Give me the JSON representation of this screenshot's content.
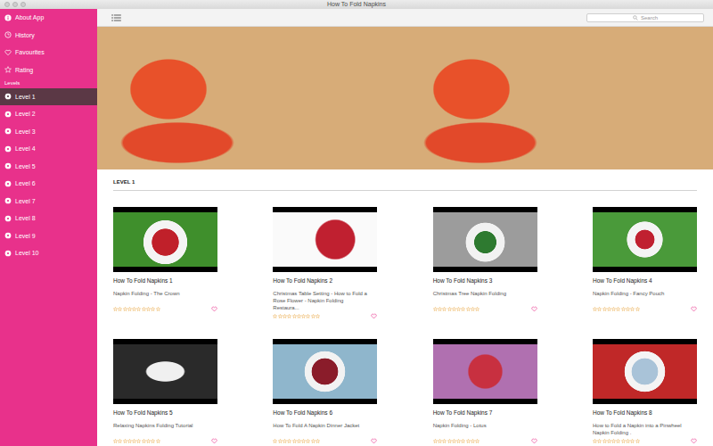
{
  "window": {
    "title": "How To Fold Napkins"
  },
  "sidebar": {
    "menu": [
      {
        "label": "About App",
        "kind": "info"
      },
      {
        "label": "History",
        "kind": "history"
      },
      {
        "label": "Favourites",
        "kind": "favourites"
      },
      {
        "label": "Rating",
        "kind": "rating"
      }
    ],
    "levels_label": "Levels",
    "levels": [
      {
        "label": "Level 1",
        "selected": true
      },
      {
        "label": "Level 2",
        "selected": false
      },
      {
        "label": "Level 3",
        "selected": false
      },
      {
        "label": "Level 4",
        "selected": false
      },
      {
        "label": "Level 5",
        "selected": false
      },
      {
        "label": "Level 6",
        "selected": false
      },
      {
        "label": "Level 7",
        "selected": false
      },
      {
        "label": "Level 8",
        "selected": false
      },
      {
        "label": "Level 9",
        "selected": false
      },
      {
        "label": "Level 10",
        "selected": false
      }
    ]
  },
  "search": {
    "placeholder": "Search"
  },
  "section": {
    "title": "LEVEL 1"
  },
  "star_max": 10,
  "cards": [
    {
      "title": "How To Fold Napkins 1",
      "subtitle": "Napkin Folding - The Crown",
      "stars": 0,
      "favourite": false
    },
    {
      "title": "How To Fold Napkins 2",
      "subtitle": "Christmas Table Setting - How to Fold a Rose Flower - Napkin Folding Restaura...",
      "stars": 0,
      "favourite": false
    },
    {
      "title": "How To Fold Napkins 3",
      "subtitle": "Christmas Tree Napkin Folding",
      "stars": 0,
      "favourite": false
    },
    {
      "title": "How To Fold Napkins 4",
      "subtitle": "Napkin Folding - Fancy Pouch",
      "stars": 0,
      "favourite": false
    },
    {
      "title": "How To Fold Napkins 5",
      "subtitle": "Relaxing Napkins Folding Tutorial",
      "stars": 0,
      "favourite": false
    },
    {
      "title": "How To Fold Napkins 6",
      "subtitle": "How To Fold A Napkin Dinner Jacket",
      "stars": 0,
      "favourite": false
    },
    {
      "title": "How To Fold Napkins 7",
      "subtitle": "Napkin Folding - Lotus",
      "stars": 0,
      "favourite": false
    },
    {
      "title": "How To Fold Napkins 8",
      "subtitle": "How to Fold a Napkin into a Pinwheel  Napkin Folding .",
      "stars": 0,
      "favourite": false
    }
  ]
}
